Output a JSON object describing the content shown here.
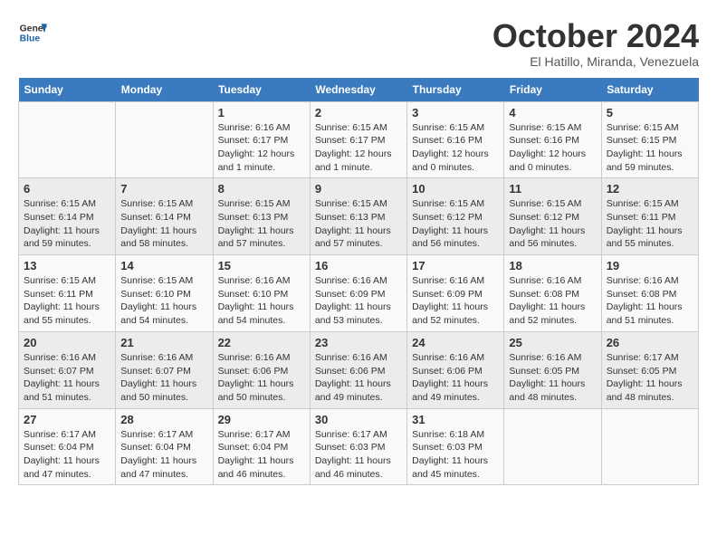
{
  "logo": {
    "line1": "General",
    "line2": "Blue"
  },
  "title": "October 2024",
  "subtitle": "El Hatillo, Miranda, Venezuela",
  "weekdays": [
    "Sunday",
    "Monday",
    "Tuesday",
    "Wednesday",
    "Thursday",
    "Friday",
    "Saturday"
  ],
  "weeks": [
    [
      {
        "day": "",
        "info": ""
      },
      {
        "day": "",
        "info": ""
      },
      {
        "day": "1",
        "info": "Sunrise: 6:16 AM\nSunset: 6:17 PM\nDaylight: 12 hours\nand 1 minute."
      },
      {
        "day": "2",
        "info": "Sunrise: 6:15 AM\nSunset: 6:17 PM\nDaylight: 12 hours\nand 1 minute."
      },
      {
        "day": "3",
        "info": "Sunrise: 6:15 AM\nSunset: 6:16 PM\nDaylight: 12 hours\nand 0 minutes."
      },
      {
        "day": "4",
        "info": "Sunrise: 6:15 AM\nSunset: 6:16 PM\nDaylight: 12 hours\nand 0 minutes."
      },
      {
        "day": "5",
        "info": "Sunrise: 6:15 AM\nSunset: 6:15 PM\nDaylight: 11 hours\nand 59 minutes."
      }
    ],
    [
      {
        "day": "6",
        "info": "Sunrise: 6:15 AM\nSunset: 6:14 PM\nDaylight: 11 hours\nand 59 minutes."
      },
      {
        "day": "7",
        "info": "Sunrise: 6:15 AM\nSunset: 6:14 PM\nDaylight: 11 hours\nand 58 minutes."
      },
      {
        "day": "8",
        "info": "Sunrise: 6:15 AM\nSunset: 6:13 PM\nDaylight: 11 hours\nand 57 minutes."
      },
      {
        "day": "9",
        "info": "Sunrise: 6:15 AM\nSunset: 6:13 PM\nDaylight: 11 hours\nand 57 minutes."
      },
      {
        "day": "10",
        "info": "Sunrise: 6:15 AM\nSunset: 6:12 PM\nDaylight: 11 hours\nand 56 minutes."
      },
      {
        "day": "11",
        "info": "Sunrise: 6:15 AM\nSunset: 6:12 PM\nDaylight: 11 hours\nand 56 minutes."
      },
      {
        "day": "12",
        "info": "Sunrise: 6:15 AM\nSunset: 6:11 PM\nDaylight: 11 hours\nand 55 minutes."
      }
    ],
    [
      {
        "day": "13",
        "info": "Sunrise: 6:15 AM\nSunset: 6:11 PM\nDaylight: 11 hours\nand 55 minutes."
      },
      {
        "day": "14",
        "info": "Sunrise: 6:15 AM\nSunset: 6:10 PM\nDaylight: 11 hours\nand 54 minutes."
      },
      {
        "day": "15",
        "info": "Sunrise: 6:16 AM\nSunset: 6:10 PM\nDaylight: 11 hours\nand 54 minutes."
      },
      {
        "day": "16",
        "info": "Sunrise: 6:16 AM\nSunset: 6:09 PM\nDaylight: 11 hours\nand 53 minutes."
      },
      {
        "day": "17",
        "info": "Sunrise: 6:16 AM\nSunset: 6:09 PM\nDaylight: 11 hours\nand 52 minutes."
      },
      {
        "day": "18",
        "info": "Sunrise: 6:16 AM\nSunset: 6:08 PM\nDaylight: 11 hours\nand 52 minutes."
      },
      {
        "day": "19",
        "info": "Sunrise: 6:16 AM\nSunset: 6:08 PM\nDaylight: 11 hours\nand 51 minutes."
      }
    ],
    [
      {
        "day": "20",
        "info": "Sunrise: 6:16 AM\nSunset: 6:07 PM\nDaylight: 11 hours\nand 51 minutes."
      },
      {
        "day": "21",
        "info": "Sunrise: 6:16 AM\nSunset: 6:07 PM\nDaylight: 11 hours\nand 50 minutes."
      },
      {
        "day": "22",
        "info": "Sunrise: 6:16 AM\nSunset: 6:06 PM\nDaylight: 11 hours\nand 50 minutes."
      },
      {
        "day": "23",
        "info": "Sunrise: 6:16 AM\nSunset: 6:06 PM\nDaylight: 11 hours\nand 49 minutes."
      },
      {
        "day": "24",
        "info": "Sunrise: 6:16 AM\nSunset: 6:06 PM\nDaylight: 11 hours\nand 49 minutes."
      },
      {
        "day": "25",
        "info": "Sunrise: 6:16 AM\nSunset: 6:05 PM\nDaylight: 11 hours\nand 48 minutes."
      },
      {
        "day": "26",
        "info": "Sunrise: 6:17 AM\nSunset: 6:05 PM\nDaylight: 11 hours\nand 48 minutes."
      }
    ],
    [
      {
        "day": "27",
        "info": "Sunrise: 6:17 AM\nSunset: 6:04 PM\nDaylight: 11 hours\nand 47 minutes."
      },
      {
        "day": "28",
        "info": "Sunrise: 6:17 AM\nSunset: 6:04 PM\nDaylight: 11 hours\nand 47 minutes."
      },
      {
        "day": "29",
        "info": "Sunrise: 6:17 AM\nSunset: 6:04 PM\nDaylight: 11 hours\nand 46 minutes."
      },
      {
        "day": "30",
        "info": "Sunrise: 6:17 AM\nSunset: 6:03 PM\nDaylight: 11 hours\nand 46 minutes."
      },
      {
        "day": "31",
        "info": "Sunrise: 6:18 AM\nSunset: 6:03 PM\nDaylight: 11 hours\nand 45 minutes."
      },
      {
        "day": "",
        "info": ""
      },
      {
        "day": "",
        "info": ""
      }
    ]
  ]
}
